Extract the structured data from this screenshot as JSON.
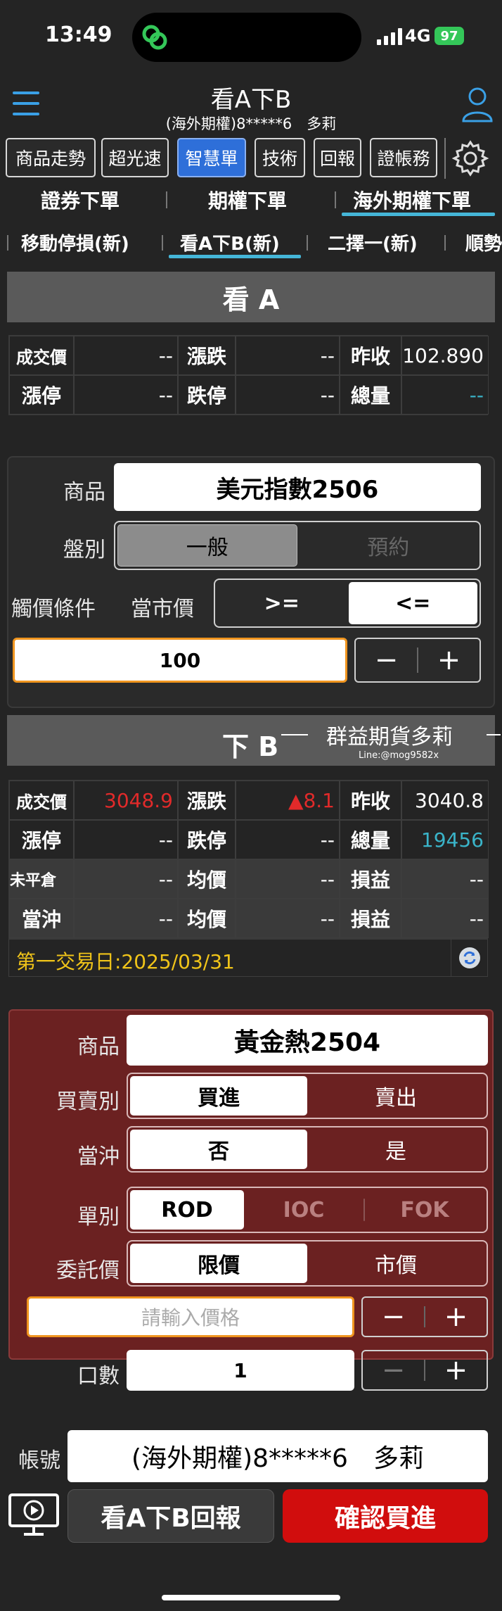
{
  "status": {
    "time": "13:49",
    "network": "4G",
    "battery": "97"
  },
  "header": {
    "title": "看A下B",
    "account_line": "(海外期權)8*****6　多莉"
  },
  "toolbar": [
    {
      "label": "商品走勢"
    },
    {
      "label": "超光速"
    },
    {
      "label": "智慧單",
      "active": true
    },
    {
      "label": "技術"
    },
    {
      "label": "回報"
    },
    {
      "label": "證帳務"
    }
  ],
  "tabs_row1": [
    "證券下單",
    "期權下單",
    "海外期權下單"
  ],
  "tabs_row2": [
    "移動停損(新)",
    "看A下B(新)",
    "二擇一(新)",
    "順勢"
  ],
  "sectionA": {
    "title": "看 A",
    "quote": {
      "last_label": "成交價",
      "last": "--",
      "chg_label": "漲跌",
      "chg": "--",
      "prev_label": "昨收",
      "prev": "102.890",
      "up_label": "漲停",
      "up": "--",
      "down_label": "跌停",
      "down": "--",
      "vol_label": "總量",
      "vol": "--"
    },
    "form": {
      "product_label": "商品",
      "product": "美元指數2506",
      "type_label": "盤別",
      "type_opts": [
        "一般",
        "預約"
      ],
      "trigger_label": "觸價條件",
      "trigger_ref": "當市價",
      "trigger_opts": [
        ">=",
        "<="
      ],
      "trigger_value": "100",
      "minus": "−",
      "plus": "+"
    }
  },
  "sectionB": {
    "title": "下 B",
    "watermark": {
      "text": "群益期貨多莉",
      "line": "Line:@mog9582x"
    },
    "quote": {
      "last_label": "成交價",
      "last": "3048.9",
      "chg_label": "漲跌",
      "chg": "▲8.1",
      "prev_label": "昨收",
      "prev": "3040.8",
      "up_label": "漲停",
      "up": "--",
      "down_label": "跌停",
      "down": "--",
      "vol_label": "總量",
      "vol": "19456",
      "open_label": "未平倉",
      "open": "--",
      "avg_label": "均價",
      "avg": "--",
      "pnl_label": "損益",
      "pnl": "--",
      "day_label": "當沖",
      "day": "--",
      "avg2_label": "均價",
      "avg2": "--",
      "pnl2_label": "損益",
      "pnl2": "--"
    },
    "first_day": "第一交易日:2025/03/31",
    "form": {
      "product_label": "商品",
      "product": "黃金熱2504",
      "side_label": "買賣別",
      "side_opts": [
        "買進",
        "賣出"
      ],
      "daytrade_label": "當沖",
      "daytrade_opts": [
        "否",
        "是"
      ],
      "ordtype_label": "單別",
      "ordtype_opts": [
        "ROD",
        "IOC",
        "FOK"
      ],
      "price_label": "委託價",
      "price_opts": [
        "限價",
        "市價"
      ],
      "price_placeholder": "請輸入價格",
      "qty_label": "口數",
      "qty": "1",
      "minus": "−",
      "plus": "+"
    }
  },
  "account": {
    "label": "帳號",
    "value": "(海外期權)8*****6　多莉"
  },
  "bottom": {
    "report_button": "看A下B回報",
    "confirm_button": "確認買進"
  },
  "colors": {
    "accent": "#45b6d8",
    "active_blue": "#2e6fd9",
    "confirm_red": "#d10d0d",
    "panel_red": "#6b2121",
    "up_red": "#e12a2a"
  }
}
